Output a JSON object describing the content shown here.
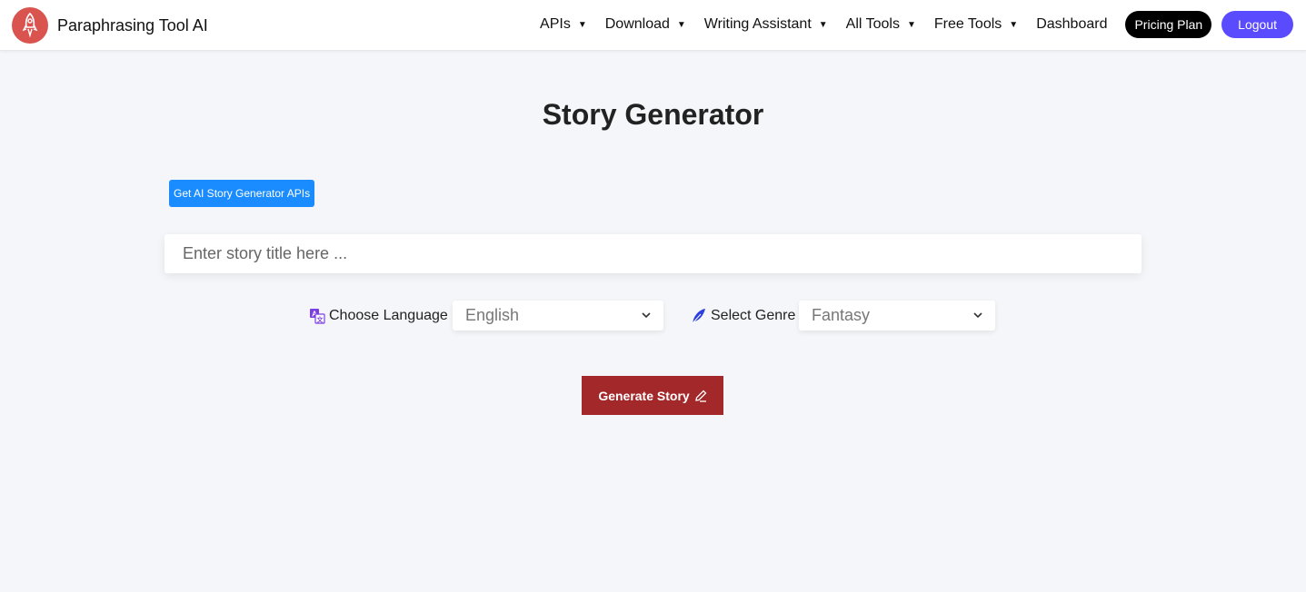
{
  "brand": {
    "name": "Paraphrasing Tool AI",
    "logo_icon": "rocket-icon"
  },
  "nav": {
    "items": [
      {
        "label": "APIs",
        "dropdown": true
      },
      {
        "label": "Download",
        "dropdown": true
      },
      {
        "label": "Writing Assistant",
        "dropdown": true
      },
      {
        "label": "All Tools",
        "dropdown": true
      },
      {
        "label": "Free Tools",
        "dropdown": true
      },
      {
        "label": "Dashboard",
        "dropdown": false
      }
    ],
    "caret": "▼",
    "pricing_label": "Pricing Plan",
    "logout_label": "Logout"
  },
  "page": {
    "title": "Story Generator",
    "api_button": "Get AI Story Generator APIs",
    "story_input": {
      "placeholder": "Enter story title here ...",
      "value": ""
    },
    "language": {
      "label": "Choose Language",
      "icon": "translate-icon",
      "selected": "English"
    },
    "genre": {
      "label": "Select Genre",
      "icon": "feather-icon",
      "selected": "Fantasy"
    },
    "generate_label": "Generate Story",
    "generate_icon": "pencil-icon"
  },
  "colors": {
    "logo_bg": "#d9534f",
    "api_button": "#1a8cff",
    "logout": "#5a4bff",
    "pricing": "#000000",
    "generate": "#a3282a",
    "background": "#f4f6f9"
  }
}
